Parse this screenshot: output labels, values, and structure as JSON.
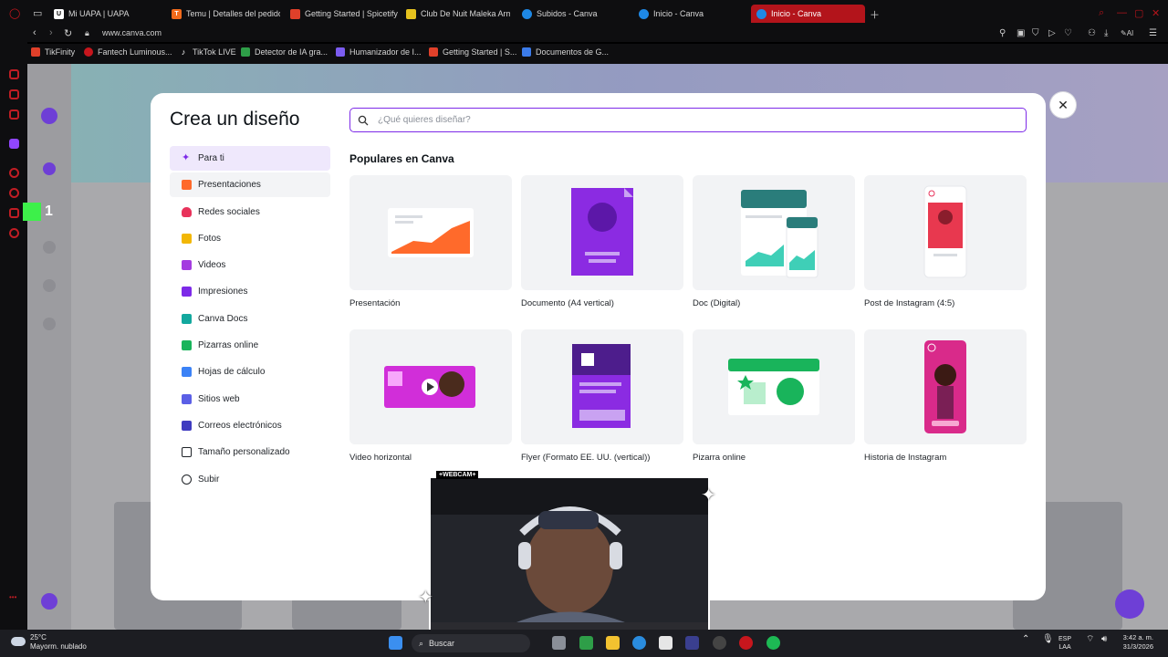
{
  "browser": {
    "tabs": [
      {
        "label": "Mi UAPA | UAPA",
        "icon": "uapa-icon",
        "color": "#ffffff"
      },
      {
        "label": "Temu | Detalles del pedido",
        "icon": "temu-icon",
        "color": "#f36b1c"
      },
      {
        "label": "Getting Started | Spicetify",
        "icon": "spicetify-icon",
        "color": "#e0402a"
      },
      {
        "label": "Club De Nuit Maleka Arma...",
        "icon": "club-icon",
        "color": "#e6c21e"
      },
      {
        "label": "Subidos - Canva",
        "icon": "canva-icon",
        "color": "#1e88e5"
      },
      {
        "label": "Inicio - Canva",
        "icon": "canva-icon",
        "color": "#1e88e5"
      },
      {
        "label": "Inicio - Canva",
        "icon": "canva-icon",
        "color": "#1e88e5",
        "active": true
      }
    ],
    "url": "www.canva.com",
    "bookmarks": [
      {
        "label": "TikFinity",
        "color": "#e0402a"
      },
      {
        "label": "Fantech Luminous...",
        "color": "#c7161d"
      },
      {
        "label": "TikTok LIVE",
        "color": "#ffffff"
      },
      {
        "label": "Detector de IA gra...",
        "color": "#2e9e48"
      },
      {
        "label": "Humanizador de I...",
        "color": "#7b5cf0"
      },
      {
        "label": "Getting Started | S...",
        "color": "#e0402a"
      },
      {
        "label": "Documentos de G...",
        "color": "#3b7bea"
      }
    ],
    "accent": "#b3141b"
  },
  "modal": {
    "title": "Crea un diseño",
    "search_placeholder": "¿Qué quieres diseñar?",
    "menu": [
      {
        "label": "Para ti",
        "icon": "sparkle-icon",
        "color": "#7d2ae8"
      },
      {
        "label": "Presentaciones",
        "icon": "presentation-icon",
        "color": "#ff6a2b"
      },
      {
        "label": "Redes sociales",
        "icon": "heart-icon",
        "color": "#e8335b"
      },
      {
        "label": "Fotos",
        "icon": "photo-icon",
        "color": "#f2b705"
      },
      {
        "label": "Videos",
        "icon": "video-icon",
        "color": "#a43ce0"
      },
      {
        "label": "Impresiones",
        "icon": "printer-icon",
        "color": "#7d2ae8"
      },
      {
        "label": "Canva Docs",
        "icon": "docs-icon",
        "color": "#13a89e"
      },
      {
        "label": "Pizarras online",
        "icon": "whiteboard-icon",
        "color": "#19b45b"
      },
      {
        "label": "Hojas de cálculo",
        "icon": "spreadsheet-icon",
        "color": "#3b82f6"
      },
      {
        "label": "Sitios web",
        "icon": "website-icon",
        "color": "#5b5fe6"
      },
      {
        "label": "Correos electrónicos",
        "icon": "email-icon",
        "color": "#3f3cc0"
      },
      {
        "label": "Tamaño personalizado",
        "icon": "resize-icon",
        "color": "#1f2328"
      },
      {
        "label": "Subir",
        "icon": "cloud-upload-icon",
        "color": "#1f2328"
      }
    ],
    "section_title": "Populares en Canva",
    "designs": [
      {
        "label": "Presentación"
      },
      {
        "label": "Documento (A4 vertical)"
      },
      {
        "label": "Doc (Digital)"
      },
      {
        "label": "Post de Instagram (4:5)"
      },
      {
        "label": "Video horizontal"
      },
      {
        "label": "Flyer (Formato EE. UU. (vertical))"
      },
      {
        "label": "Pizarra online"
      },
      {
        "label": "Historia de Instagram"
      }
    ],
    "accent": "#7d2ae8"
  },
  "overlay": {
    "webcam_tag": "+WEBCAM+",
    "counter": "1"
  },
  "taskbar": {
    "temperature": "25°C",
    "weather": "Mayorm. nublado",
    "search": "Buscar",
    "lang_top": "ESP",
    "lang_bottom": "LAA",
    "time": "3:42 a. m.",
    "date": "31/3/2026"
  }
}
